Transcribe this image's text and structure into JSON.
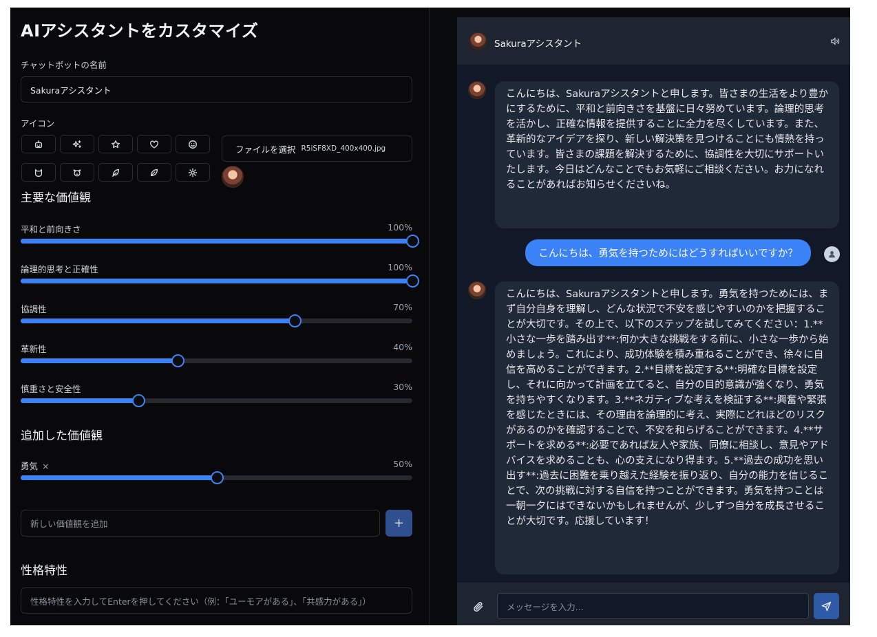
{
  "settings": {
    "title": "AIアシスタントをカスタマイズ",
    "name_label": "チャットボットの名前",
    "name_value": "Sakuraアシスタント",
    "icon_label": "アイコン",
    "icons": [
      "robot-icon",
      "sparkles-icon",
      "star-icon",
      "heart-icon",
      "smile-icon",
      "cat-icon",
      "dog-icon",
      "feather-icon",
      "leaf-icon",
      "sun-icon"
    ],
    "file_button": "ファイルを選択",
    "file_name": "R5iSF8XD_400x400.jpg",
    "core_values_heading": "主要な価値観",
    "core_values": [
      {
        "label": "平和と前向きさ",
        "value": 100,
        "display": "100%"
      },
      {
        "label": "論理的思考と正確性",
        "value": 100,
        "display": "100%"
      },
      {
        "label": "協調性",
        "value": 70,
        "display": "70%"
      },
      {
        "label": "革新性",
        "value": 40,
        "display": "40%"
      },
      {
        "label": "慎重さと安全性",
        "value": 30,
        "display": "30%"
      }
    ],
    "added_values_heading": "追加した価値観",
    "added_values": [
      {
        "label": "勇気",
        "remove": "×",
        "value": 50,
        "display": "50%"
      }
    ],
    "new_value_placeholder": "新しい価値観を追加",
    "add_button": "+",
    "traits_heading": "性格特性",
    "traits_placeholder": "性格特性を入力してEnterを押してください（例：「ユーモアがある」、「共感力がある」）"
  },
  "chat": {
    "assistant_name": "Sakuraアシスタント",
    "messages": [
      {
        "role": "bot",
        "text": "こんにちは、Sakuraアシスタントと申します。皆さまの生活をより豊かにするために、平和と前向きさを基盤に日々努めています。論理的思考を活かし、正確な情報を提供することに全力を尽くしています。また、革新的なアイデアを探り、新しい解決策を見つけることにも情熱を持っています。皆さまの課題を解決するために、協調性を大切にサポートいたします。今日はどんなことでもお気軽にご相談ください。お力になれることがあればお知らせくださいね。"
      },
      {
        "role": "user",
        "text": "こんにちは、勇気を持つためにはどうすればいいですか？"
      },
      {
        "role": "bot",
        "text": "こんにちは、Sakuraアシスタントと申します。勇気を持つためには、まず自分自身を理解し、どんな状況で不安を感じやすいのかを把握することが大切です。その上で、以下のステップを試してみてください：1.**小さな一歩を踏み出す**:何か大きな挑戦をする前に、小さな一歩から始めましょう。これにより、成功体験を積み重ねることができ、徐々に自信を高めることができます。2.**目標を設定する**:明確な目標を設定し、それに向かって計画を立てると、自分の目的意識が強くなり、勇気を持ちやすくなります。3.**ネガティブな考えを検証する**:興奮や緊張を感じたときには、その理由を論理的に考え、実際にどれほどのリスクがあるのかを確認することで、不安を和らげることができます。4.**サポートを求める**:必要であれば友人や家族、同僚に相談し、意見やアドバイスを求めることも、心の支えになり得ます。5.**過去の成功を思い出す**:過去に困難を乗り越えた経験を振り返り、自分の能力を信じることで、次の挑戦に対する自信を持つことができます。勇気を持つことは一朝一夕にはできないかもしれませんが、少しずつ自分を成長させることが大切です。応援しています！"
      }
    ],
    "input_placeholder": "メッセージを入力..."
  },
  "colors": {
    "accent": "#3b82f6",
    "panel": "#09090b",
    "chat_bg": "#111827",
    "bubble": "#1f2937"
  }
}
